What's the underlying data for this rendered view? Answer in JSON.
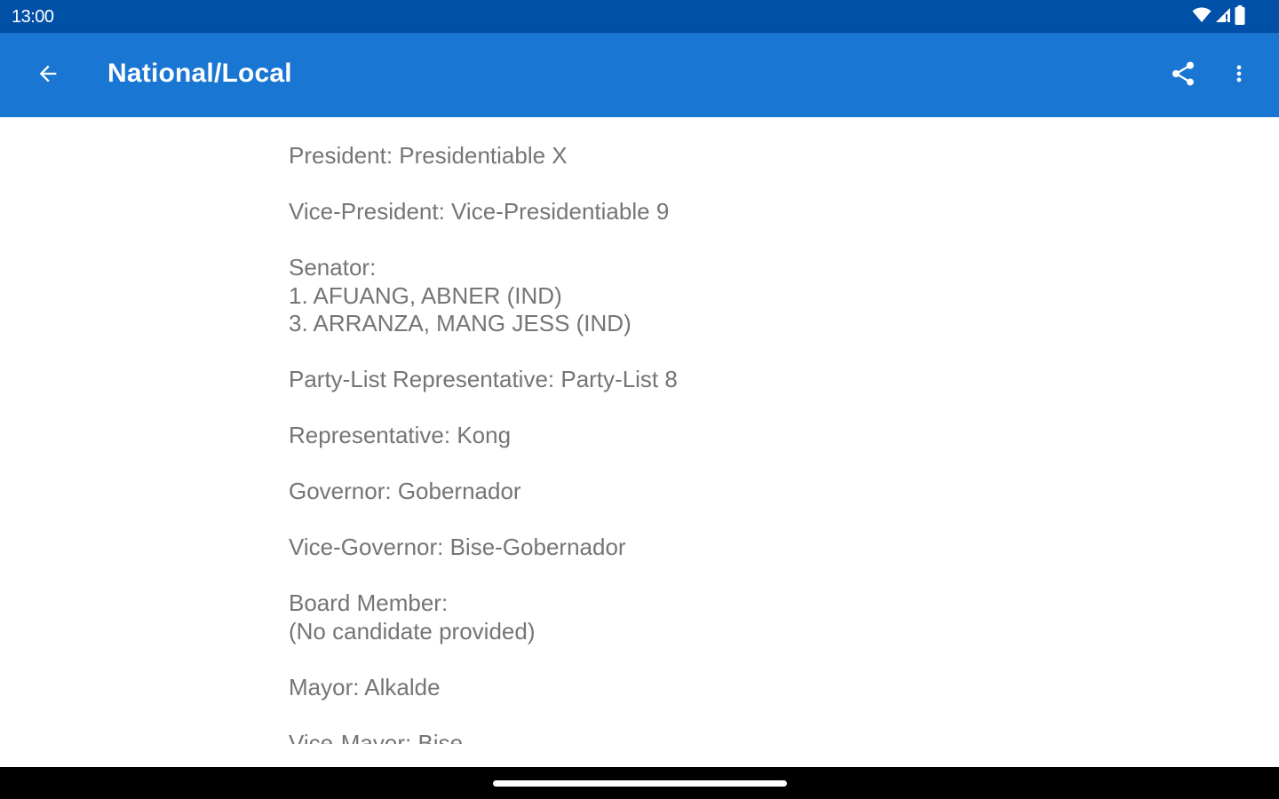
{
  "status_bar": {
    "time": "13:00",
    "icons": [
      "wifi-icon",
      "cell-signal-icon",
      "battery-icon"
    ]
  },
  "app_bar": {
    "title": "National/Local",
    "back_icon": "arrow-back-icon",
    "actions": [
      "share-icon",
      "more-vert-icon"
    ]
  },
  "ballot": {
    "president": "President: Presidentiable X",
    "vice_president": "Vice-President: Vice-Presidentiable 9",
    "senator_label": "Senator:",
    "senators": [
      "1. AFUANG, ABNER (IND)",
      "3. ARRANZA, MANG JESS (IND)"
    ],
    "party_list": "Party-List Representative: Party-List 8",
    "representative": "Representative: Kong",
    "governor": "Governor: Gobernador",
    "vice_governor": "Vice-Governor: Bise-Gobernador",
    "board_member_label": "Board Member:",
    "board_member_value": "(No candidate provided)",
    "mayor": "Mayor: Alkalde",
    "vice_mayor": "Vice-Mayor: Bise"
  },
  "colors": {
    "status_bar": "#0050a8",
    "app_bar": "#1976d2",
    "body_text": "#757575",
    "nav_bar": "#000000"
  }
}
